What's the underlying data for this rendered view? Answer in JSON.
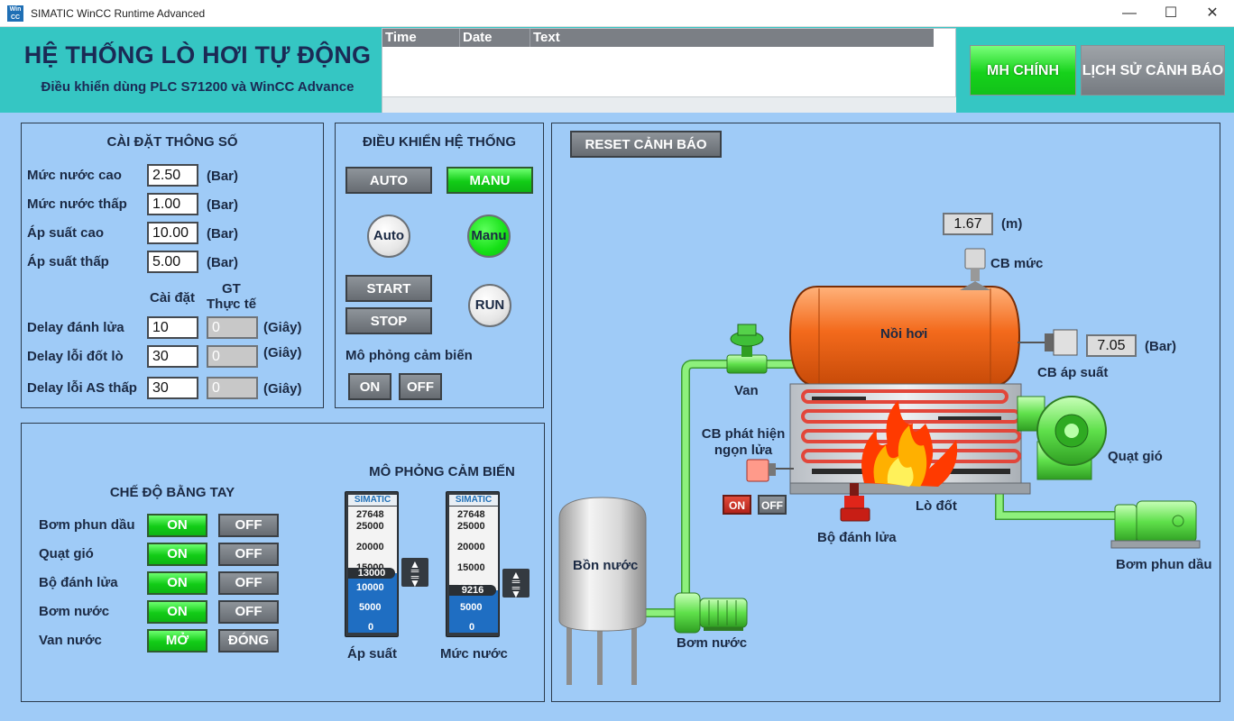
{
  "window": {
    "title": "SIMATIC WinCC Runtime Advanced",
    "minimize": "—",
    "maximize": "☐",
    "close": "✕"
  },
  "header": {
    "title": "HỆ THỐNG LÒ HƠI TỰ ĐỘNG",
    "subtitle": "Điều khiển dùng PLC S71200 và WinCC Advance",
    "alarm_columns": [
      "Time",
      "Date",
      "Text"
    ],
    "nav_main": "MH CHÍNH",
    "nav_history": "LỊCH SỬ CẢNH BÁO"
  },
  "settings": {
    "title": "CÀI ĐẶT THÔNG SỐ",
    "rows": [
      {
        "label": "Mức nước cao",
        "value": "2.50",
        "unit": "(Bar)"
      },
      {
        "label": "Mức nước thấp",
        "value": "1.00",
        "unit": "(Bar)"
      },
      {
        "label": "Áp suất cao",
        "value": "10.00",
        "unit": "(Bar)"
      },
      {
        "label": "Áp suất thấp",
        "value": "5.00",
        "unit": "(Bar)"
      }
    ],
    "col_set": "Cài đặt",
    "col_actual_1": "GT",
    "col_actual_2": "Thực tế",
    "delays": [
      {
        "label": "Delay đánh lửa",
        "set": "10",
        "actual": "0",
        "unit": "(Giây)"
      },
      {
        "label": "Delay lỗi đốt lò",
        "set": "30",
        "actual": "0",
        "unit": "(Giây)"
      },
      {
        "label": "Delay lỗi AS thấp",
        "set": "30",
        "actual": "0",
        "unit": "(Giây)"
      }
    ]
  },
  "control": {
    "title": "ĐIỀU KHIỂN HỆ THỐNG",
    "auto_button": "AUTO",
    "manu_button": "MANU",
    "auto_ind": "Auto",
    "manu_ind": "Manu",
    "start_button": "START",
    "stop_button": "STOP",
    "run_ind": "RUN",
    "sim_label": "Mô phỏng cảm biến",
    "on_button": "ON",
    "off_button": "OFF"
  },
  "manual": {
    "title": "CHẾ ĐỘ BẰNG TAY",
    "rows": [
      {
        "label": "Bơm phun dầu",
        "on": "ON",
        "off": "OFF"
      },
      {
        "label": "Quạt gió",
        "on": "ON",
        "off": "OFF"
      },
      {
        "label": "Bộ đánh lửa",
        "on": "ON",
        "off": "OFF"
      },
      {
        "label": "Bơm nước",
        "on": "ON",
        "off": "OFF"
      },
      {
        "label": "Van nước",
        "on": "MỞ",
        "off": "ĐÓNG"
      }
    ]
  },
  "sim": {
    "title": "MÔ PHỎNG CẢM BIẾN",
    "brand": "SIMATIC",
    "ticks": [
      "27648",
      "25000",
      "20000",
      "15000",
      "10000",
      "5000",
      "0"
    ],
    "pressure": {
      "label": "Áp suất",
      "value": "13000",
      "fraction": 0.47
    },
    "level": {
      "label": "Mức nước",
      "value": "9216",
      "fraction": 0.333
    }
  },
  "process": {
    "reset_button": "RESET CẢNH BÁO",
    "level_value": "1.67",
    "level_unit": "(m)",
    "level_sensor": "CB mức",
    "boiler": "Nồi hơi",
    "pressure_value": "7.05",
    "pressure_unit": "(Bar)",
    "pressure_sensor": "CB áp suất",
    "valve": "Van",
    "flame_sensor_1": "CB phát hiện",
    "flame_sensor_2": "ngọn lửa",
    "flame_on": "ON",
    "flame_off": "OFF",
    "fan": "Quạt gió",
    "burner": "Lò đốt",
    "igniter": "Bộ đánh lửa",
    "tank": "Bồn nước",
    "water_pump": "Bơm nước",
    "oil_pump": "Bơm phun dầu"
  },
  "colors": {
    "background": "#9fcbf7",
    "header": "#35c6c3",
    "active_green": "#16d21b",
    "boiler_orange": "#f36a1c"
  }
}
